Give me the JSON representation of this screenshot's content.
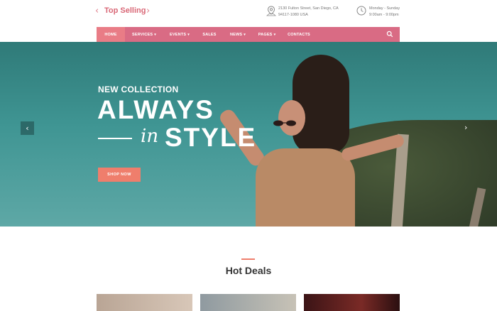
{
  "top_bar": {
    "selector_prev": "‹",
    "selector_label": "Top Selling",
    "selector_next": "›",
    "address": "2130 Fulton Street, San Diego, CA 94117-1080 USA",
    "hours": "Monday - Sunday 9:00am - 9:00pm"
  },
  "nav": {
    "items": [
      {
        "label": "HOME",
        "active": true
      },
      {
        "label": "SERVICES",
        "caret": "▾"
      },
      {
        "label": "EVENTS",
        "caret": "▾"
      },
      {
        "label": "SALES"
      },
      {
        "label": "NEWS",
        "caret": "▾"
      },
      {
        "label": "PAGES",
        "caret": "▾"
      },
      {
        "label": "CONTACTS"
      }
    ],
    "search_icon": "search-icon"
  },
  "hero": {
    "subtitle": "NEW COLLECTION",
    "title_line1": "ALWAYS",
    "title_in": "in",
    "title_line2": "STYLE",
    "cta_label": "SHOP NOW",
    "prev_arrow": "‹",
    "next_arrow": "›"
  },
  "deals": {
    "title": "Hot Deals"
  },
  "colors": {
    "accent": "#d96b84",
    "cta": "#ef7e6c",
    "hero_bg": "#3f9593"
  }
}
